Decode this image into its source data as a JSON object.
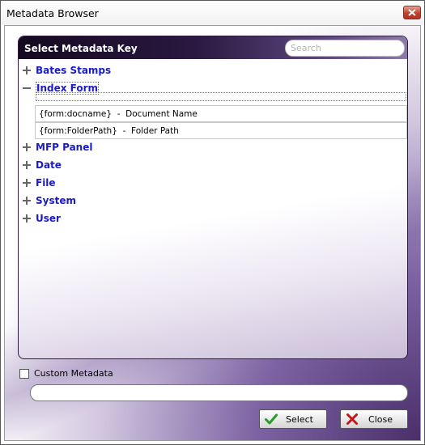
{
  "window": {
    "title": "Metadata Browser"
  },
  "panel": {
    "title": "Select Metadata Key",
    "search_placeholder": "Search"
  },
  "tree": {
    "nodes": [
      {
        "label": "Bates Stamps",
        "expanded": false
      },
      {
        "label": "Index Form",
        "expanded": true,
        "children": [
          {
            "text": "{form:docname}  -  Document Name"
          },
          {
            "text": "{form:FolderPath}  -  Folder Path"
          }
        ]
      },
      {
        "label": "MFP Panel",
        "expanded": false
      },
      {
        "label": "Date",
        "expanded": false
      },
      {
        "label": "File",
        "expanded": false
      },
      {
        "label": "System",
        "expanded": false
      },
      {
        "label": "User",
        "expanded": false
      }
    ]
  },
  "custom_metadata": {
    "label": "Custom Metadata",
    "checked": false,
    "value": ""
  },
  "buttons": {
    "select_label": "Select",
    "close_label": "Close"
  },
  "colors": {
    "node_text": "#1a1acc",
    "select_icon": "#2a9a2a",
    "close_icon": "#c01818"
  }
}
